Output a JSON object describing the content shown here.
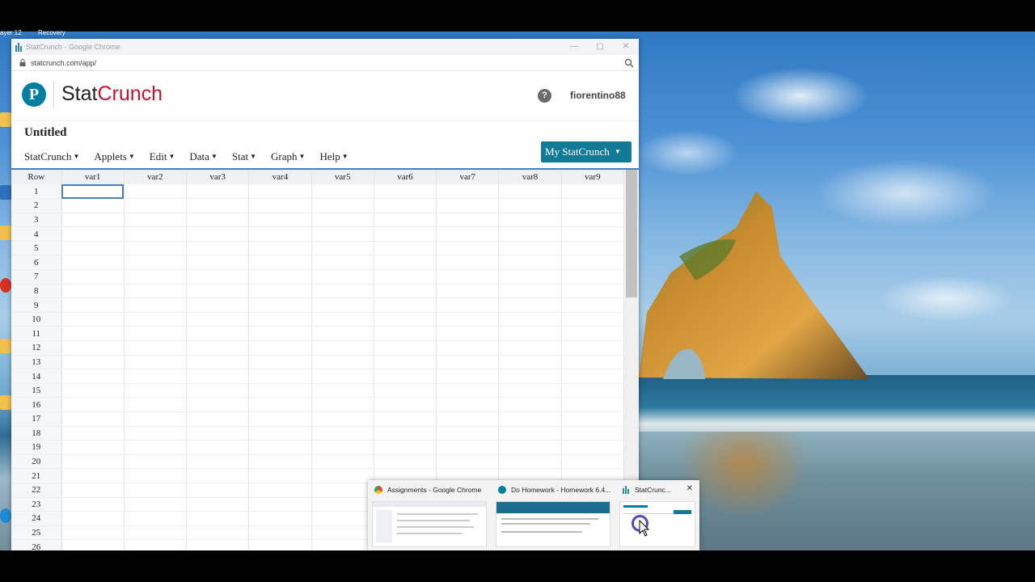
{
  "desktop": {
    "top_labels": [
      "ayer 12",
      "Recovery"
    ]
  },
  "window": {
    "title": "StatCrunch - Google Chrome",
    "url": "statcrunch.com/app/",
    "controls": [
      "—",
      "▢",
      "✕"
    ]
  },
  "statcrunch": {
    "brand_stat": "Stat",
    "brand_crunch": "Crunch",
    "logo_letter": "P",
    "help": "?",
    "username": "fiorentino88",
    "doc_title": "Untitled",
    "menu": [
      "StatCrunch",
      "Applets",
      "Edit",
      "Data",
      "Stat",
      "Graph",
      "Help"
    ],
    "my_statcrunch": "My StatCrunch"
  },
  "grid": {
    "row_header": "Row",
    "columns": [
      "var1",
      "var2",
      "var3",
      "var4",
      "var5",
      "var6",
      "var7",
      "var8",
      "var9"
    ],
    "rows": [
      "1",
      "2",
      "3",
      "4",
      "5",
      "6",
      "7",
      "8",
      "9",
      "10",
      "11",
      "12",
      "13",
      "14",
      "15",
      "16",
      "17",
      "18",
      "19",
      "20",
      "21",
      "22",
      "23",
      "24",
      "25",
      "26"
    ],
    "selected_cell": "var1 row 1"
  },
  "taskbar_thumbnails": [
    {
      "title": "Assignments - Google Chrome",
      "icon": "chrome-icon"
    },
    {
      "title": "Do Homework - Homework 6.4...",
      "icon": "pearson-icon"
    },
    {
      "title": "StatCrunc...",
      "icon": "statcrunch-icon"
    }
  ],
  "thumb_close": "✕",
  "colors": {
    "brand_teal": "#007fa3",
    "crunch_red": "#c8102e",
    "button_teal": "#137a95",
    "selection_blue": "#4a7fbf"
  }
}
